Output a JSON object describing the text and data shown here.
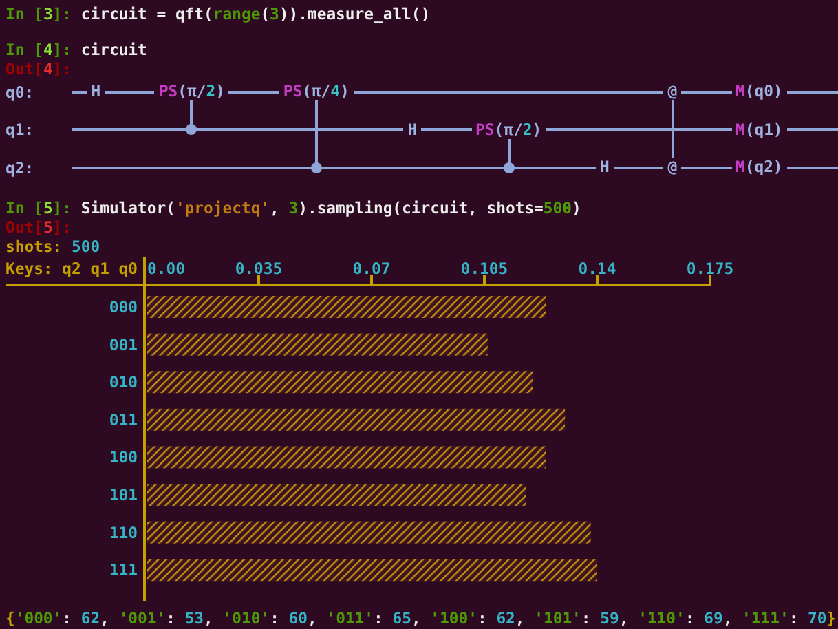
{
  "cells": [
    {
      "kind": "input",
      "tokens": [
        {
          "text": "In [",
          "color": "#4e9a06"
        },
        {
          "text": "3",
          "color": "#8ae234"
        },
        {
          "text": "]: ",
          "color": "#4e9a06"
        },
        {
          "text": "circuit = qft(",
          "color": "#eeeeec"
        },
        {
          "text": "range",
          "color": "#4e9a06"
        },
        {
          "text": "(",
          "color": "#eeeeec"
        },
        {
          "text": "3",
          "color": "#4e9a06"
        },
        {
          "text": ")).measure_all()",
          "color": "#eeeeec"
        }
      ]
    },
    {
      "kind": "input",
      "tokens": [
        {
          "text": "In [",
          "color": "#4e9a06"
        },
        {
          "text": "4",
          "color": "#8ae234"
        },
        {
          "text": "]: ",
          "color": "#4e9a06"
        },
        {
          "text": "circuit",
          "color": "#eeeeec"
        }
      ]
    },
    {
      "kind": "output",
      "tokens": [
        {
          "text": "Out[",
          "color": "#a40000"
        },
        {
          "text": "4",
          "color": "#ef2929"
        },
        {
          "text": "]:",
          "color": "#a40000"
        }
      ]
    },
    {
      "kind": "circuit",
      "qubits": [
        "q0:",
        "q1:",
        "q2:"
      ],
      "moments": [
        {
          "ops": [
            {
              "kind": "gate",
              "tokens": [
                {
                  "text": "H",
                  "color": "#9fb2e0"
                }
              ]
            },
            {
              "kind": "wire"
            },
            {
              "kind": "wire"
            }
          ]
        },
        {
          "linked": true,
          "ops": [
            {
              "kind": "gate",
              "tokens": [
                {
                  "text": "PS",
                  "color": "#c43cc4"
                },
                {
                  "text": "(π/",
                  "color": "#9fb2e0"
                },
                {
                  "text": "2",
                  "color": "#34c4c4"
                },
                {
                  "text": ")",
                  "color": "#9fb2e0"
                }
              ]
            },
            {
              "kind": "control"
            },
            {
              "kind": "wire"
            }
          ]
        },
        {
          "linked": true,
          "ops": [
            {
              "kind": "gate",
              "tokens": [
                {
                  "text": "PS",
                  "color": "#c43cc4"
                },
                {
                  "text": "(π/",
                  "color": "#9fb2e0"
                },
                {
                  "text": "4",
                  "color": "#34c4c4"
                },
                {
                  "text": ")",
                  "color": "#9fb2e0"
                }
              ]
            },
            {
              "kind": "wire"
            },
            {
              "kind": "control"
            }
          ]
        },
        {
          "ops": [
            {
              "kind": "wire"
            },
            {
              "kind": "gate",
              "tokens": [
                {
                  "text": "H",
                  "color": "#9fb2e0"
                }
              ]
            },
            {
              "kind": "wire"
            }
          ]
        },
        {
          "linked": true,
          "ops": [
            {
              "kind": "wire"
            },
            {
              "kind": "gate",
              "tokens": [
                {
                  "text": "PS",
                  "color": "#c43cc4"
                },
                {
                  "text": "(π/",
                  "color": "#9fb2e0"
                },
                {
                  "text": "2",
                  "color": "#34c4c4"
                },
                {
                  "text": ")",
                  "color": "#9fb2e0"
                }
              ]
            },
            {
              "kind": "control"
            }
          ]
        },
        {
          "ops": [
            {
              "kind": "wire"
            },
            {
              "kind": "wire"
            },
            {
              "kind": "gate",
              "tokens": [
                {
                  "text": "H",
                  "color": "#9fb2e0"
                }
              ]
            }
          ]
        },
        {
          "linked": true,
          "ops": [
            {
              "kind": "gate",
              "tokens": [
                {
                  "text": "@",
                  "color": "#9fb2e0"
                }
              ]
            },
            {
              "kind": "wire"
            },
            {
              "kind": "gate",
              "tokens": [
                {
                  "text": "@",
                  "color": "#9fb2e0"
                }
              ]
            }
          ]
        },
        {
          "linked": false,
          "ops": [
            {
              "kind": "gate",
              "tokens": [
                {
                  "text": "M",
                  "color": "#c43cc4"
                },
                {
                  "text": "(q0)",
                  "color": "#9fb2e0"
                }
              ]
            },
            {
              "kind": "gate",
              "tokens": [
                {
                  "text": "M",
                  "color": "#c43cc4"
                },
                {
                  "text": "(q1)",
                  "color": "#9fb2e0"
                }
              ]
            },
            {
              "kind": "gate",
              "tokens": [
                {
                  "text": "M",
                  "color": "#c43cc4"
                },
                {
                  "text": "(q2)",
                  "color": "#9fb2e0"
                }
              ]
            }
          ]
        }
      ]
    },
    {
      "kind": "input",
      "tokens": [
        {
          "text": "In [",
          "color": "#4e9a06"
        },
        {
          "text": "5",
          "color": "#8ae234"
        },
        {
          "text": "]: ",
          "color": "#4e9a06"
        },
        {
          "text": "Simulator(",
          "color": "#eeeeec"
        },
        {
          "text": "'projectq'",
          "color": "#c17d11"
        },
        {
          "text": ", ",
          "color": "#eeeeec"
        },
        {
          "text": "3",
          "color": "#4e9a06"
        },
        {
          "text": ").sampling(circuit, shots=",
          "color": "#eeeeec"
        },
        {
          "text": "500",
          "color": "#4e9a06"
        },
        {
          "text": ")",
          "color": "#eeeeec"
        }
      ]
    },
    {
      "kind": "output",
      "tokens": [
        {
          "text": "Out[",
          "color": "#a40000"
        },
        {
          "text": "5",
          "color": "#ef2929"
        },
        {
          "text": "]:",
          "color": "#a40000"
        }
      ]
    },
    {
      "kind": "text",
      "tokens": [
        {
          "text": "shots: ",
          "color": "#c4a000"
        },
        {
          "text": "500",
          "color": "#34b4c4"
        }
      ]
    },
    {
      "kind": "chart",
      "chart_data": {
        "type": "bar",
        "orientation": "horizontal",
        "ylabel": "Keys: q2 q1 q0",
        "categories": [
          "000",
          "001",
          "010",
          "011",
          "100",
          "101",
          "110",
          "111"
        ],
        "series": [
          {
            "color": "#c8900f",
            "values": [
              0.124,
              0.106,
              0.12,
              0.13,
              0.124,
              0.118,
              0.138,
              0.14
            ]
          }
        ],
        "xlim": [
          0,
          0.175
        ],
        "xticks": [
          {
            "value": 0,
            "label": "0.00"
          },
          0.035,
          0.07,
          0.105,
          0.14,
          0.175
        ]
      }
    },
    {
      "kind": "text",
      "tokens": [
        {
          "text": "{",
          "color": "#c4a000"
        },
        {
          "text": "'000'",
          "color": "#4e9a06"
        },
        {
          "text": ": ",
          "color": "#eeeeec"
        },
        {
          "text": "62",
          "color": "#34b4c4"
        },
        {
          "text": ", ",
          "color": "#eeeeec"
        },
        {
          "text": "'001'",
          "color": "#4e9a06"
        },
        {
          "text": ": ",
          "color": "#eeeeec"
        },
        {
          "text": "53",
          "color": "#34b4c4"
        },
        {
          "text": ", ",
          "color": "#eeeeec"
        },
        {
          "text": "'010'",
          "color": "#4e9a06"
        },
        {
          "text": ": ",
          "color": "#eeeeec"
        },
        {
          "text": "60",
          "color": "#34b4c4"
        },
        {
          "text": ", ",
          "color": "#eeeeec"
        },
        {
          "text": "'011'",
          "color": "#4e9a06"
        },
        {
          "text": ": ",
          "color": "#eeeeec"
        },
        {
          "text": "65",
          "color": "#34b4c4"
        },
        {
          "text": ", ",
          "color": "#eeeeec"
        },
        {
          "text": "'100'",
          "color": "#4e9a06"
        },
        {
          "text": ": ",
          "color": "#eeeeec"
        },
        {
          "text": "62",
          "color": "#34b4c4"
        },
        {
          "text": ", ",
          "color": "#eeeeec"
        },
        {
          "text": "'101'",
          "color": "#4e9a06"
        },
        {
          "text": ": ",
          "color": "#eeeeec"
        },
        {
          "text": "59",
          "color": "#34b4c4"
        },
        {
          "text": ", ",
          "color": "#eeeeec"
        },
        {
          "text": "'110'",
          "color": "#4e9a06"
        },
        {
          "text": ": ",
          "color": "#eeeeec"
        },
        {
          "text": "69",
          "color": "#34b4c4"
        },
        {
          "text": ", ",
          "color": "#eeeeec"
        },
        {
          "text": "'111'",
          "color": "#4e9a06"
        },
        {
          "text": ": ",
          "color": "#eeeeec"
        },
        {
          "text": "70",
          "color": "#34b4c4"
        },
        {
          "text": "}",
          "color": "#c4a000"
        }
      ]
    }
  ]
}
